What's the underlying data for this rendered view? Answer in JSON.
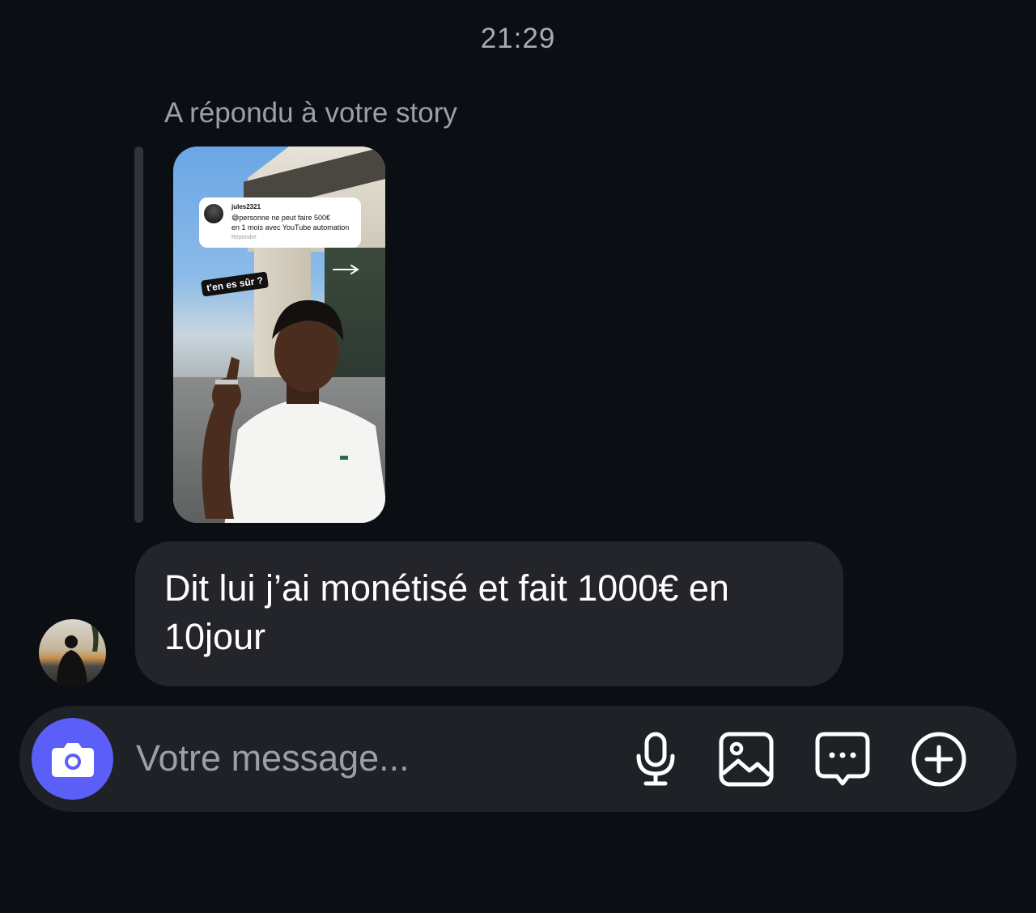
{
  "header": {
    "time": "21:29"
  },
  "story_reply": {
    "label": "A répondu à votre story",
    "story": {
      "comment_username": "jules2321",
      "comment_line1": "😅personne ne peut faire 500€",
      "comment_line2": "en 1 mois avec YouTube automation",
      "comment_reply_label": "Répondre",
      "sticker_text": "t'en es sûr ?"
    }
  },
  "message": {
    "text": "Dit lui j’ai monétisé et fait 1000€ en 10jour"
  },
  "composer": {
    "placeholder": "Votre message...",
    "icons": [
      "camera-icon",
      "microphone-icon",
      "image-icon",
      "sticker-icon",
      "add-icon"
    ],
    "accent_color": "#5b5ef7"
  },
  "colors": {
    "background": "#0b0f14",
    "bubble": "#23252b",
    "composer": "#1e2126",
    "muted_text": "#9aa0a8"
  }
}
